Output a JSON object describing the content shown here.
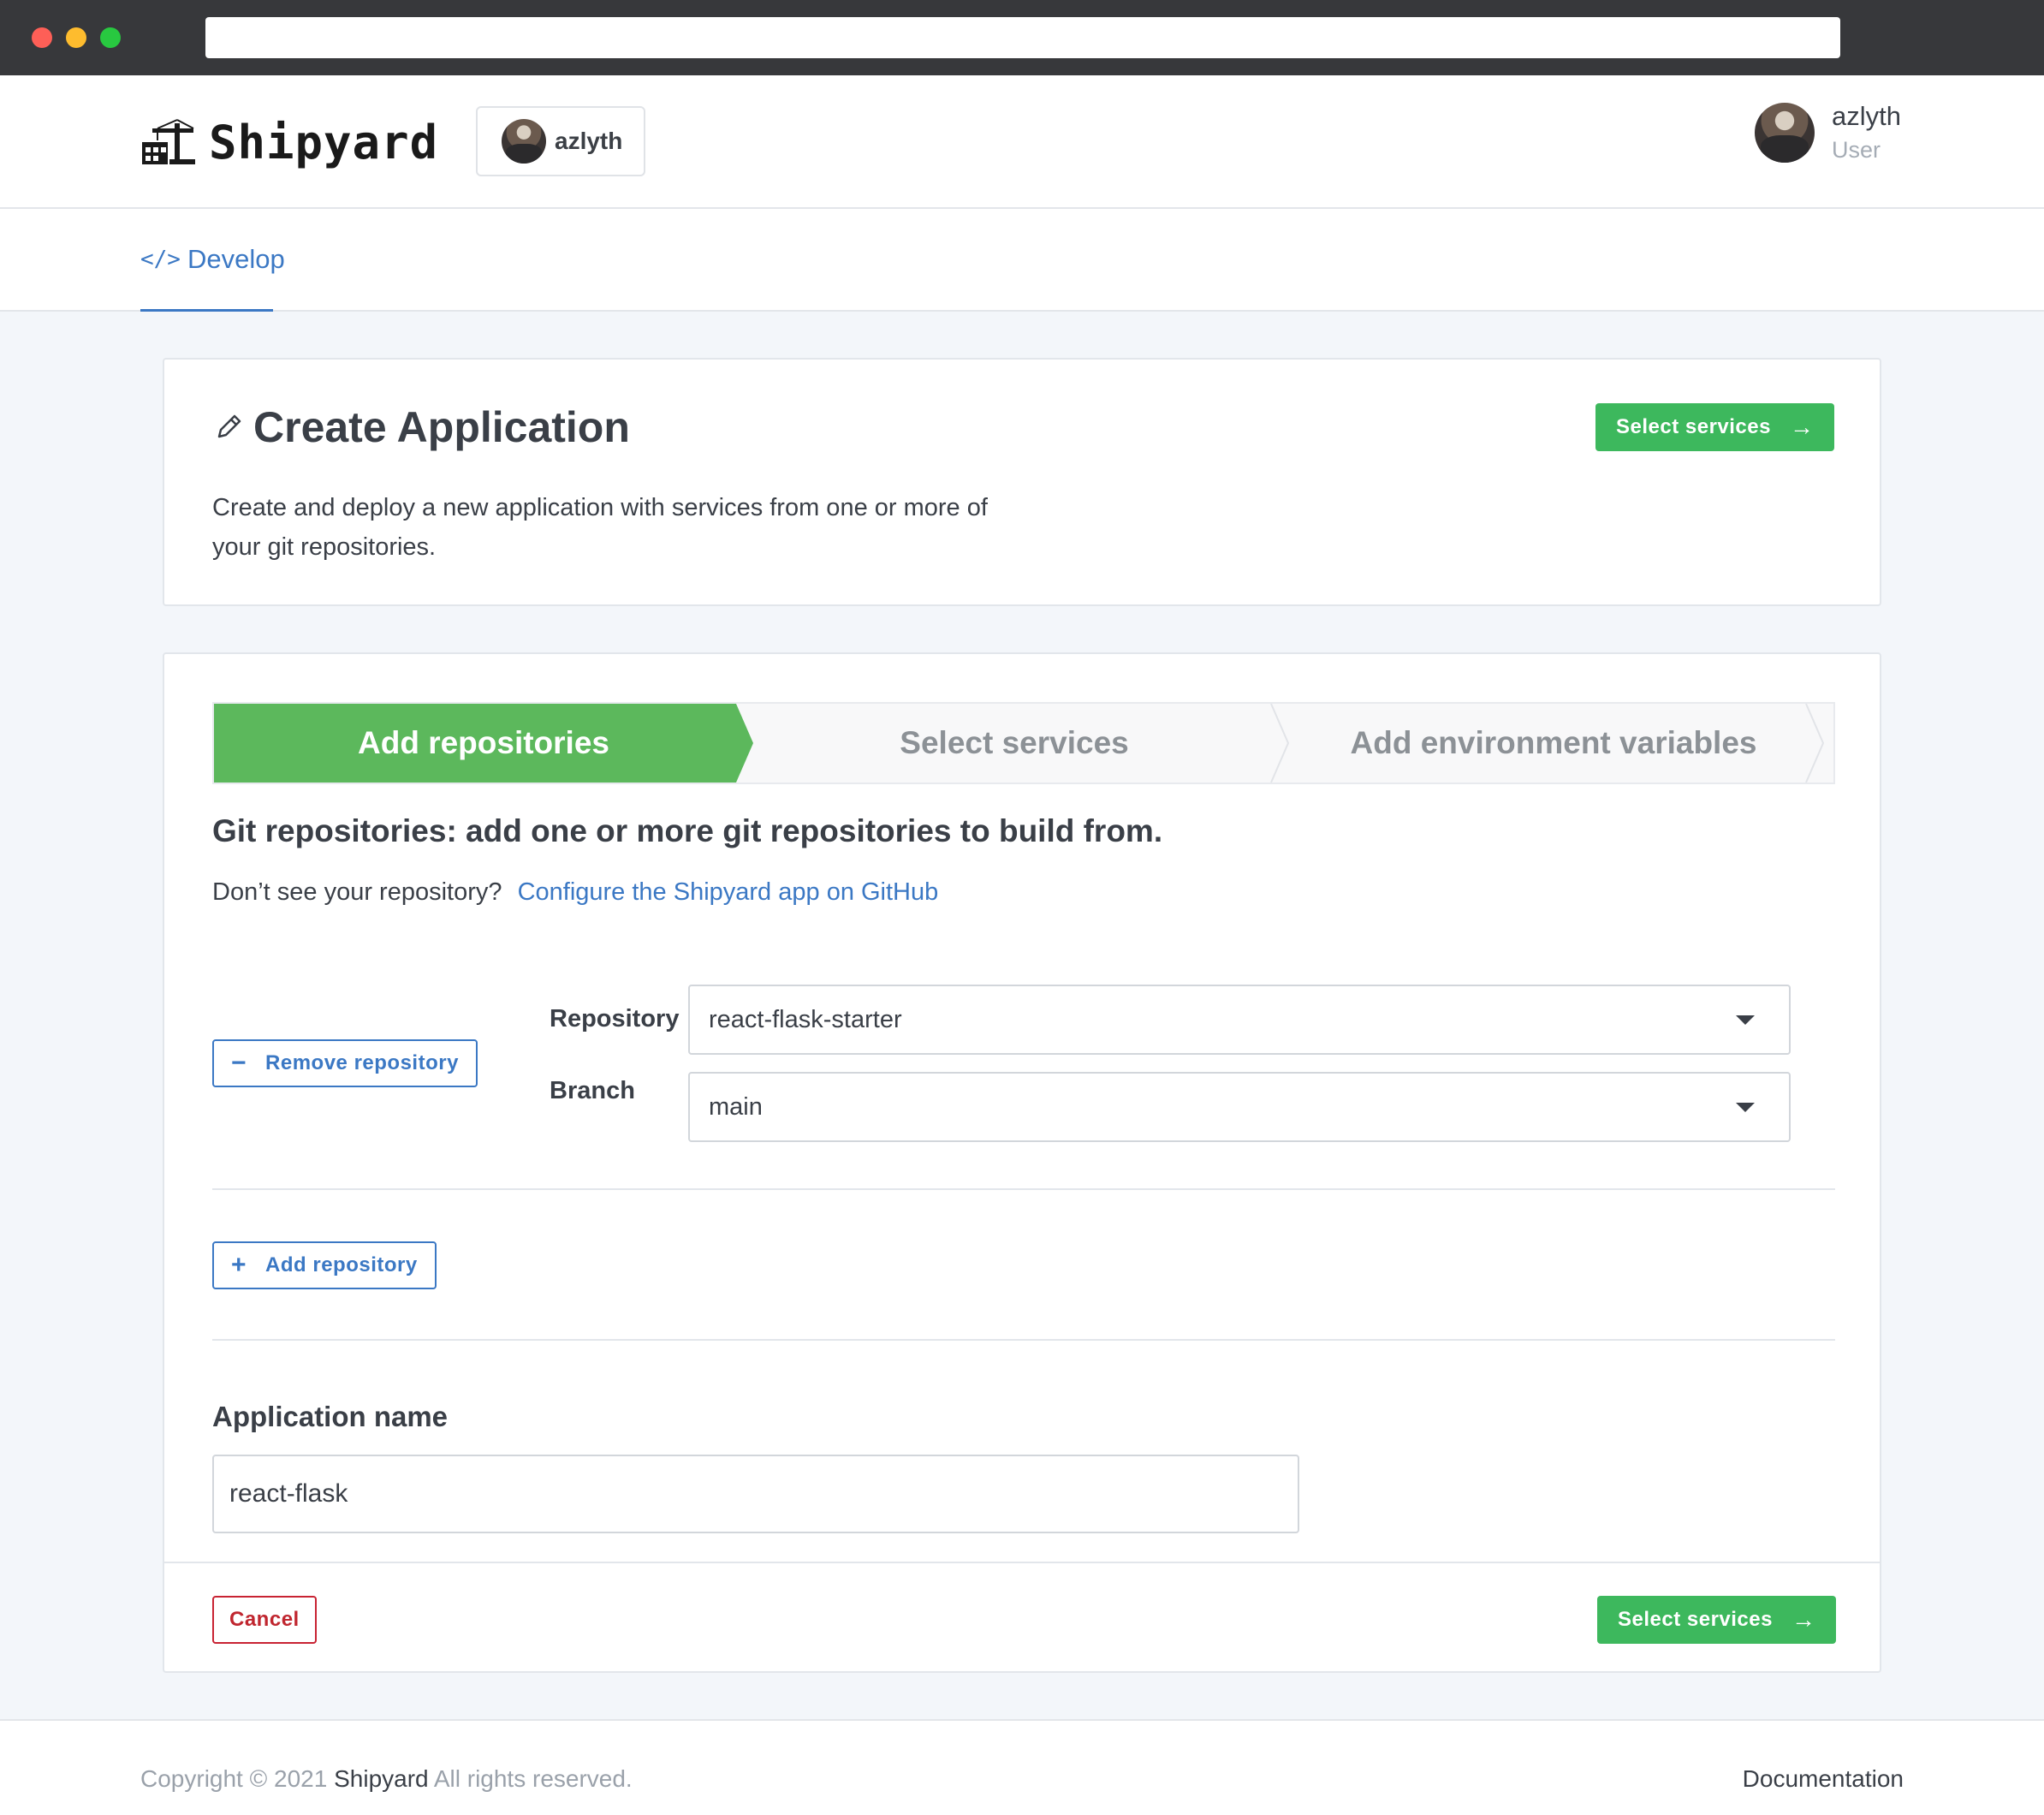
{
  "header": {
    "brand": "Shipyard",
    "org_name": "azlyth",
    "user_name": "azlyth",
    "user_role": "User"
  },
  "nav": {
    "tabs": [
      {
        "label": "Develop",
        "icon": "code-icon",
        "active": true
      }
    ]
  },
  "create": {
    "title": "Create Application",
    "description": "Create and deploy a new application with services from one or more of your git repositories.",
    "next_button": "Select services"
  },
  "wizard": {
    "steps": [
      {
        "label": "Add repositories",
        "active": true
      },
      {
        "label": "Select services",
        "active": false
      },
      {
        "label": "Add environment variables",
        "active": false
      }
    ],
    "heading": "Git repositories: add one or more git repositories to build from.",
    "help_text": "Don’t see your repository?",
    "help_link": "Configure the Shipyard app on GitHub",
    "remove_button": "Remove repository",
    "repository_label": "Repository",
    "repository_value": "react-flask-starter",
    "branch_label": "Branch",
    "branch_value": "main",
    "add_button": "Add repository",
    "app_name_label": "Application name",
    "app_name_value": "react-flask",
    "cancel_button": "Cancel",
    "next_button": "Select services"
  },
  "footer": {
    "copyright_prefix": "Copyright © 2021",
    "brand": "Shipyard",
    "copyright_suffix": "All rights reserved.",
    "docs_link": "Documentation"
  },
  "colors": {
    "primary_green": "#3db85d",
    "active_step": "#5cb85c",
    "link_blue": "#3b78c4",
    "danger_red": "#c82333",
    "page_bg": "#f3f6fa"
  }
}
